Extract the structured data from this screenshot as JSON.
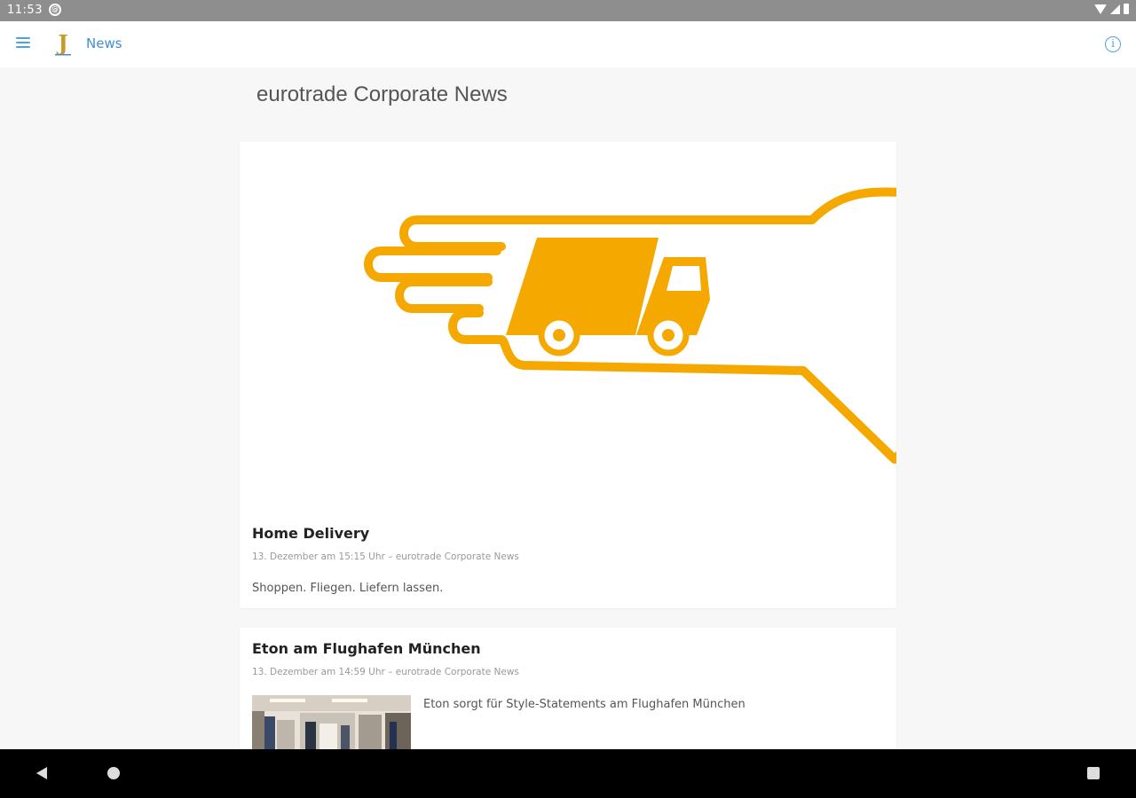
{
  "status_bar": {
    "time": "11:53",
    "notification_glyph": "@"
  },
  "app_bar": {
    "title": "News",
    "logo_letter": "J",
    "accent_color": "#3d8fd1",
    "info_glyph": "i"
  },
  "page": {
    "heading": "eurotrade Corporate News"
  },
  "articles": [
    {
      "title": "Home Delivery",
      "meta": "13. Dezember am 15:15 Uhr – eurotrade Corporate News",
      "excerpt": "Shoppen. Fliegen. Liefern lassen.",
      "image_icon": "delivery-truck-location-pin-icon",
      "image_color": "#f5a800"
    },
    {
      "title": "Eton am Flughafen München",
      "meta": "13. Dezember am 14:59 Uhr – eurotrade Corporate News",
      "excerpt": "Eton sorgt für Style-Statements am Flughafen München",
      "image_icon": "store-interior-photo"
    }
  ]
}
